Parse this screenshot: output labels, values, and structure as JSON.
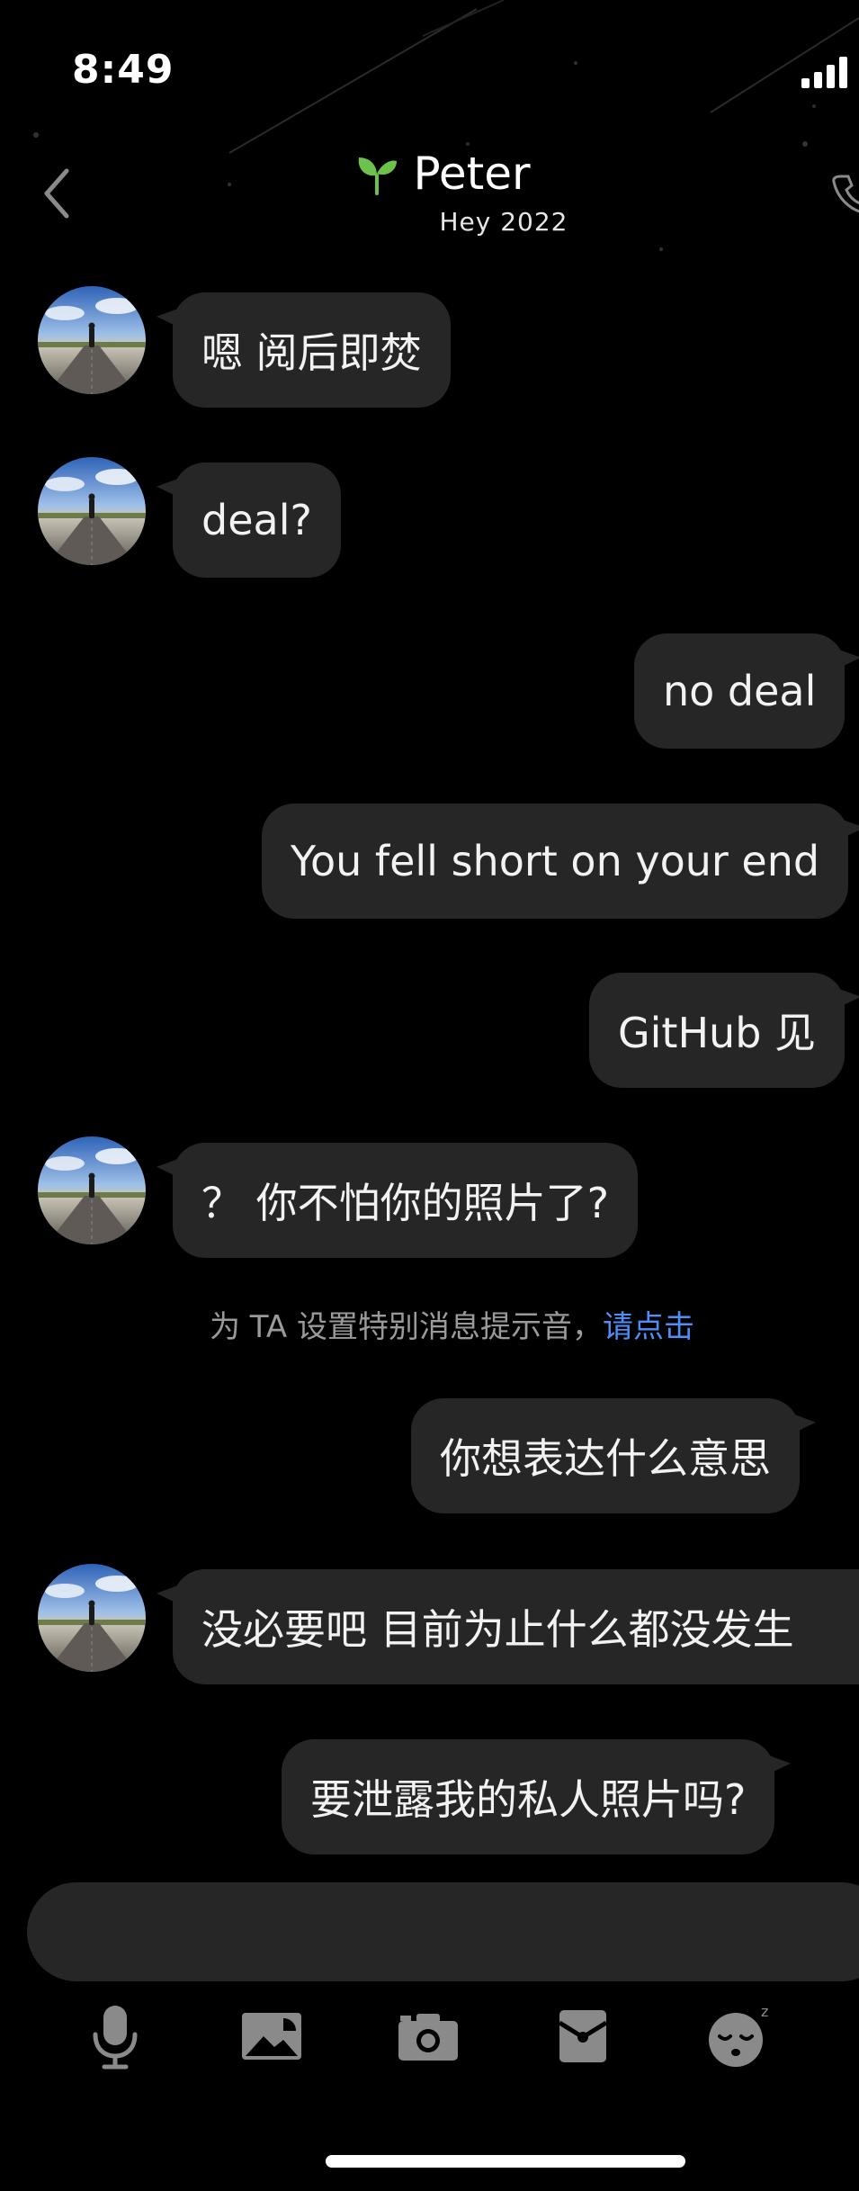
{
  "status_bar": {
    "time": "8:49"
  },
  "header": {
    "title": "Peter",
    "subtitle": "Hey 2022"
  },
  "messages": [
    {
      "direction": "in",
      "text": "嗯 阅后即焚"
    },
    {
      "direction": "in",
      "text": "deal?"
    },
    {
      "direction": "out",
      "text": "no deal"
    },
    {
      "direction": "out",
      "text": "You fell short on your end"
    },
    {
      "direction": "out",
      "text": "GitHub 见"
    },
    {
      "direction": "in",
      "text": "？ 你不怕你的照片了?"
    },
    {
      "direction": "out",
      "text": "你想表达什么意思"
    },
    {
      "direction": "in",
      "text": "没必要吧 目前为止什么都没发生"
    },
    {
      "direction": "out",
      "text": "要泄露我的私人照片吗?"
    }
  ],
  "system_note": {
    "text": "为 TA 设置特别消息提示音，",
    "link": "请点击"
  },
  "input": {
    "placeholder": ""
  },
  "toolbar": {
    "icons": [
      "microphone-icon",
      "image-icon",
      "camera-icon",
      "red-packet-icon",
      "sleepy-emoji-icon"
    ]
  },
  "colors": {
    "background": "#000000",
    "bubble": "#262626",
    "link": "#4f8ef7",
    "sprout": "#6cc24a"
  }
}
